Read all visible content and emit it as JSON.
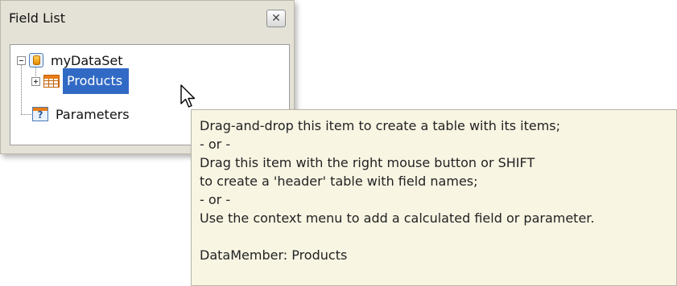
{
  "panel": {
    "title": "Field List",
    "close_glyph": "✕"
  },
  "tree": {
    "nodes": [
      {
        "label": "myDataSet",
        "icon": "database-icon",
        "expander": "collapse"
      },
      {
        "label": "Products",
        "icon": "table-icon",
        "expander": "expand",
        "selected": true
      },
      {
        "label": "Parameters",
        "icon": "parameters-icon",
        "expander": "none"
      }
    ]
  },
  "tooltip": {
    "lines": [
      "Drag-and-drop this item to create a table with its items;",
      "- or -",
      "Drag this item with the right mouse button or SHIFT",
      "to create a 'header' table with field names;",
      "- or -",
      "Use the context menu to add a calculated field or parameter.",
      "DataMember: Products"
    ]
  },
  "colors": {
    "selection": "#316ac5",
    "panel_bg": "#e4e1d6",
    "tooltip_bg": "#f8f5e3"
  }
}
